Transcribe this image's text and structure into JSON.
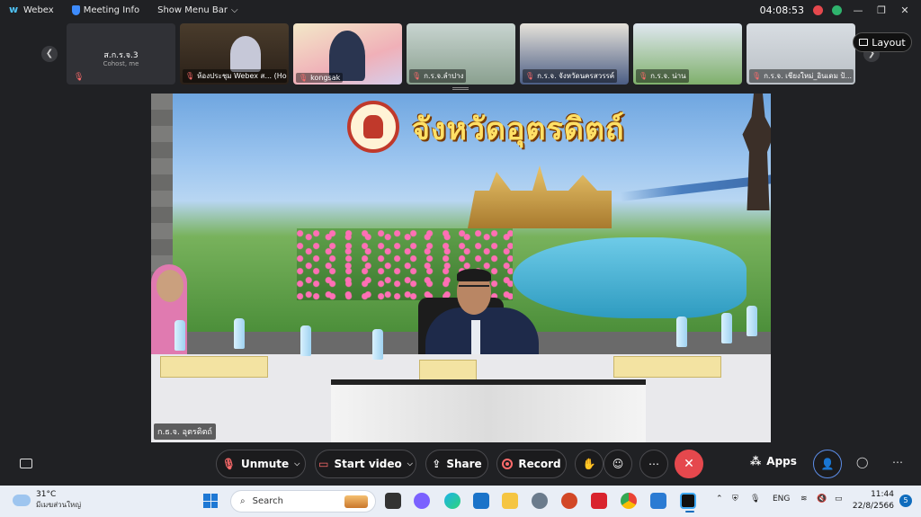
{
  "topbar": {
    "app_name": "Webex",
    "meeting_info": "Meeting Info",
    "show_menu": "Show Menu Bar",
    "timer": "04:08:53"
  },
  "participants": [
    {
      "name": "ส.ก.ร.จ.3",
      "subtitle": "Cohost, me"
    },
    {
      "name": "ห้องประชุม Webex ส... (Host)"
    },
    {
      "name": "kongsak"
    },
    {
      "name": "ก.ร.จ.ลำปาง"
    },
    {
      "name": "ก.ร.จ. จังหวัดนครสวรรค์"
    },
    {
      "name": "ก.ร.จ. น่าน"
    },
    {
      "name": "ก.ร.จ. เชียงใหม่_อินเดม ป้..."
    }
  ],
  "layout_label": "Layout",
  "main_video": {
    "banner_title": "จังหวัดอุตรดิตถ์",
    "speaker_label": "ก.ธ.จ. อุตรดิตถ์"
  },
  "controls": {
    "unmute": "Unmute",
    "start_video": "Start video",
    "share": "Share",
    "record": "Record",
    "apps": "Apps"
  },
  "taskbar": {
    "temperature": "31°C",
    "weather_desc": "มีเมฆส่วนใหญ่",
    "search_placeholder": "Search",
    "language": "ENG",
    "time": "11:44",
    "date": "22/8/2566",
    "notification_count": "5"
  },
  "colors": {
    "end_call": "#e5484d",
    "accent_blue": "#0f6cbd",
    "banner_title": "#ffe066"
  }
}
